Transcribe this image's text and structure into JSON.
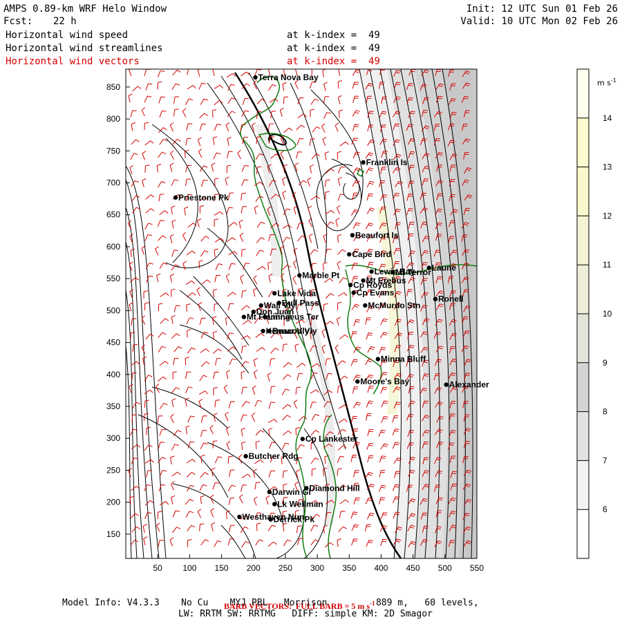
{
  "header": {
    "title": "AMPS 0.89-km WRF Helo Window",
    "forecast_label": "Fcst:",
    "forecast_hours": "22 h",
    "init": "Init: 12 UTC Sun 01 Feb 26",
    "valid": "Valid: 10 UTC Mon 02 Feb 26"
  },
  "fields": [
    {
      "name": "Horizontal wind speed",
      "level": "at k-index =  49",
      "color": "#000000"
    },
    {
      "name": "Horizontal wind streamlines",
      "level": "at k-index =  49",
      "color": "#000000"
    },
    {
      "name": "Horizontal wind vectors",
      "level": "at k-index =  49",
      "color": "#d40000"
    }
  ],
  "colorbar": {
    "unit": "m s",
    "unit_sup": "-1",
    "levels": [
      "6",
      "7",
      "8",
      "9",
      "10",
      "11",
      "12",
      "13",
      "14"
    ],
    "colors": [
      "#ffffff",
      "#f2f2f2",
      "#e2e2e2",
      "#d4d4d4",
      "#e4e4da",
      "#eeeed8",
      "#f4f4d4",
      "#f8f8cc",
      "#fbfbcf",
      "#fffff0"
    ]
  },
  "axes": {
    "x_ticks": [
      "50",
      "100",
      "150",
      "200",
      "250",
      "300",
      "350",
      "400",
      "450",
      "500",
      "550"
    ],
    "y_ticks": [
      "850",
      "800",
      "750",
      "700",
      "650",
      "600",
      "550",
      "500",
      "450",
      "400",
      "350",
      "300",
      "250",
      "200",
      "150"
    ]
  },
  "places": [
    {
      "name": "Terra Nova Bay",
      "x": 203,
      "y": 865
    },
    {
      "name": "Franklin Is",
      "x": 372,
      "y": 732
    },
    {
      "name": "Priestone Pk",
      "x": 78,
      "y": 677
    },
    {
      "name": "Beaufort Is",
      "x": 355,
      "y": 618
    },
    {
      "name": "Cape Bird",
      "x": 350,
      "y": 588
    },
    {
      "name": "Marble Pt",
      "x": 272,
      "y": 555
    },
    {
      "name": "Lewis Bay",
      "x": 385,
      "y": 561
    },
    {
      "name": "Mt Terror",
      "x": 418,
      "y": 560
    },
    {
      "name": "Laune",
      "x": 475,
      "y": 567
    },
    {
      "name": "Cp Royds",
      "x": 352,
      "y": 540
    },
    {
      "name": "Mt Erebus",
      "x": 372,
      "y": 547
    },
    {
      "name": "Lake Vida",
      "x": 233,
      "y": 527
    },
    {
      "name": "Cp Evans",
      "x": 357,
      "y": 528
    },
    {
      "name": "Ronell",
      "x": 485,
      "y": 518
    },
    {
      "name": "Wall Vly",
      "x": 212,
      "y": 508
    },
    {
      "name": "Bull Pass",
      "x": 240,
      "y": 512
    },
    {
      "name": "McMurdo Stn",
      "x": 375,
      "y": 508
    },
    {
      "name": "Don Juan",
      "x": 200,
      "y": 498
    },
    {
      "name": "Mt Fleming",
      "x": 185,
      "y": 490
    },
    {
      "name": "Linnaeus Ter",
      "x": 218,
      "y": 490
    },
    {
      "name": "Kennar Vly",
      "x": 215,
      "y": 468
    },
    {
      "name": "Beacon Vly",
      "x": 225,
      "y": 468
    },
    {
      "name": "Minna Bluff",
      "x": 395,
      "y": 424
    },
    {
      "name": "Moore's Bay",
      "x": 363,
      "y": 389
    },
    {
      "name": "Alexander",
      "x": 502,
      "y": 384
    },
    {
      "name": "Cp Lankester",
      "x": 277,
      "y": 299
    },
    {
      "name": "Butcher Rdg",
      "x": 188,
      "y": 272
    },
    {
      "name": "Diamond Hill",
      "x": 283,
      "y": 222
    },
    {
      "name": "Darwin Gl",
      "x": 225,
      "y": 216
    },
    {
      "name": "Lk Wellman",
      "x": 233,
      "y": 197
    },
    {
      "name": "Westhaven Nun",
      "x": 178,
      "y": 177
    },
    {
      "name": "Derrick Pk",
      "x": 227,
      "y": 173
    }
  ],
  "footer": {
    "barb_text": "BARB VECTORS:  FULL BARB = 5 m s",
    "barb_sup": "-1",
    "model_info": "Model Info: V4.3.3    No Cu    MYJ PBL   Morrison         889 m,   60 levels,",
    "model_info2": "LW: RRTM SW: RRTMG   DIFF: simple KM: 2D Smagor"
  }
}
